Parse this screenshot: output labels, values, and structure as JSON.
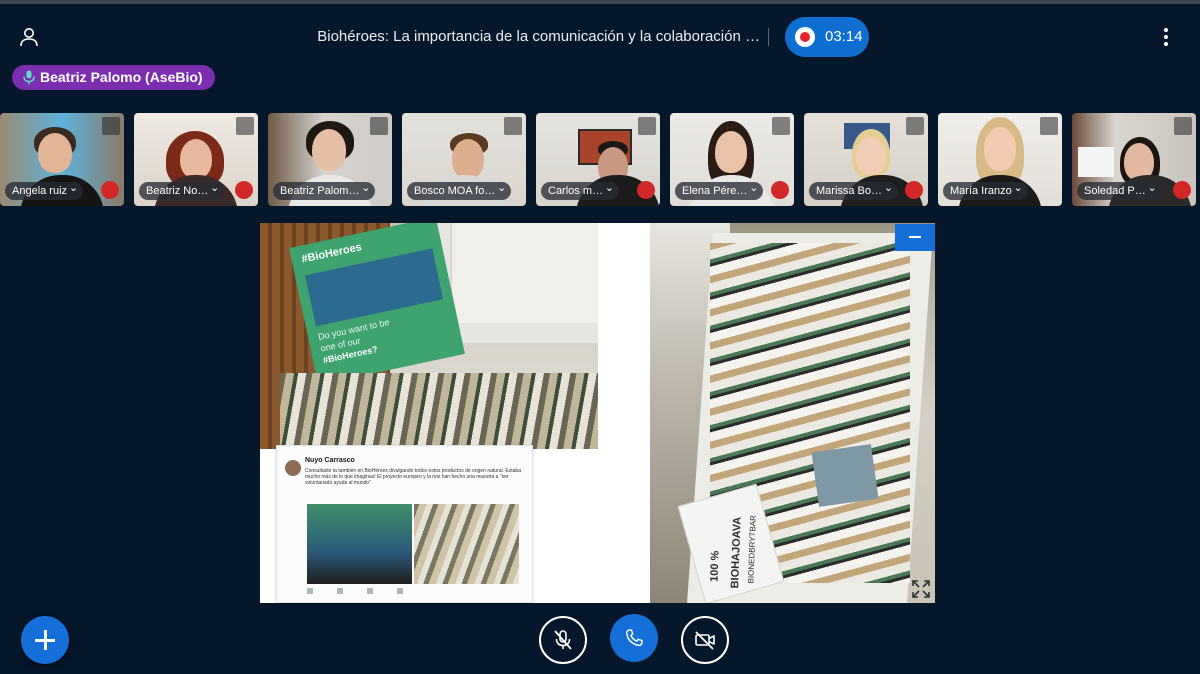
{
  "header": {
    "title": "Biohéroes: La importancia de la comunicación y la colaboración …",
    "recording_time": "03:14"
  },
  "active_speaker": "Beatriz Palomo (AseBio)",
  "participants": [
    {
      "name": "Angela ruiz",
      "muted": true
    },
    {
      "name": "Beatriz No…",
      "muted": true
    },
    {
      "name": "Beatriz Palom…",
      "muted": false
    },
    {
      "name": "Bosco MOA fo…",
      "muted": false
    },
    {
      "name": "Carlos m…",
      "muted": true
    },
    {
      "name": "Elena Pére…",
      "muted": true
    },
    {
      "name": "Marissa Bo…",
      "muted": true
    },
    {
      "name": "María Iranzo",
      "muted": false
    },
    {
      "name": "Soledad P…",
      "muted": true
    }
  ],
  "shared_content": {
    "banner_lines": [
      "#BioHeroes",
      "Do you want to be",
      "one of our",
      "#BioHeroes?"
    ],
    "tweet": {
      "author": "Nuyo Carrasco",
      "text": "Consultaste ta también en BioHéroes divulgando todos estos productos de origen natural. Estaba mucho más de lo que imaginas! El proyecto europeo y la nos han hecho una muestra a \"ser voluntariado ayuda al mundo\""
    },
    "bag_text": [
      "100 %",
      "BIOHAJOAVA",
      "BIONEDBRYTBAR"
    ]
  },
  "colors": {
    "background": "#06172b",
    "accent": "#1470d8",
    "speaker_tag": "#7b2fb0",
    "muted": "#d32828",
    "record": "#e2222d"
  }
}
